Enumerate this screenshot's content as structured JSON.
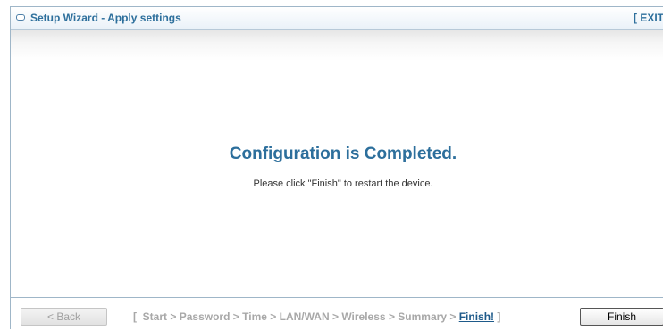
{
  "window": {
    "title": "Setup Wizard - Apply settings",
    "exit_label": "[ EXIT"
  },
  "main": {
    "heading": "Configuration is Completed.",
    "message": "Please click \"Finish\" to restart the device."
  },
  "footer": {
    "back_label": "< Back",
    "finish_label": "Finish",
    "steps": {
      "open_bracket": "[",
      "items": [
        "Start",
        "Password",
        "Time",
        "LAN/WAN",
        "Wireless",
        "Summary",
        "Finish!"
      ],
      "separator": ">",
      "close_bracket": "]",
      "current": "Finish!"
    }
  },
  "colors": {
    "accent": "#2d6f9c",
    "border": "#9fb6c8",
    "inactive_step": "#a8a8a8",
    "active_step": "#1e5a8a"
  }
}
